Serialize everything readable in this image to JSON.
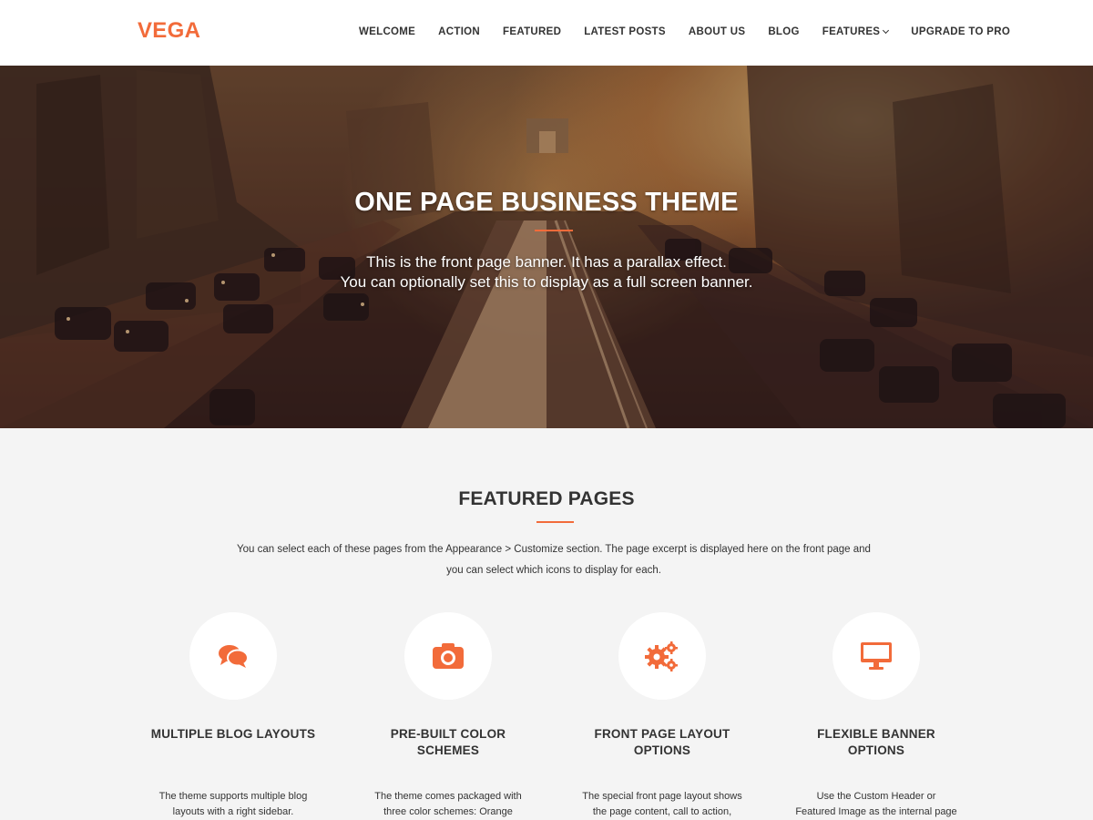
{
  "site": {
    "logo": "VEGA",
    "accent": "#f26b3a"
  },
  "nav": {
    "items": [
      {
        "label": "WELCOME"
      },
      {
        "label": "ACTION"
      },
      {
        "label": "FEATURED"
      },
      {
        "label": "LATEST POSTS"
      },
      {
        "label": "ABOUT US"
      },
      {
        "label": "BLOG"
      },
      {
        "label": "FEATURES",
        "has_dropdown": true
      },
      {
        "label": "UPGRADE TO PRO"
      }
    ]
  },
  "hero": {
    "title": "ONE PAGE BUSINESS THEME",
    "subtitle_line1": "This is the front page banner. It has a parallax effect.",
    "subtitle_line2": "You can optionally set this to display as a full screen banner."
  },
  "featured": {
    "title": "FEATURED PAGES",
    "description_line1": "You can select each of these pages from the Appearance > Customize section. The page excerpt is displayed here on the front page and",
    "description_line2": "you can select which icons to display for each.",
    "cards": [
      {
        "icon": "comments-icon",
        "title_line1": "MULTIPLE BLOG LAYOUTS",
        "title_line2": "",
        "text_line1": "The theme supports multiple blog",
        "text_line2": "layouts with a right sidebar."
      },
      {
        "icon": "camera-icon",
        "title_line1": "PRE-BUILT COLOR",
        "title_line2": "SCHEMES",
        "text_line1": "The theme comes packaged with",
        "text_line2": "three color schemes: Orange"
      },
      {
        "icon": "gears-icon",
        "title_line1": "FRONT PAGE LAYOUT",
        "title_line2": "OPTIONS",
        "text_line1": "The special front page layout shows",
        "text_line2": "the page content, call to action,"
      },
      {
        "icon": "desktop-icon",
        "title_line1": "FLEXIBLE BANNER",
        "title_line2": "OPTIONS",
        "text_line1": "Use the Custom Header or",
        "text_line2": "Featured Image as the internal page"
      }
    ]
  }
}
